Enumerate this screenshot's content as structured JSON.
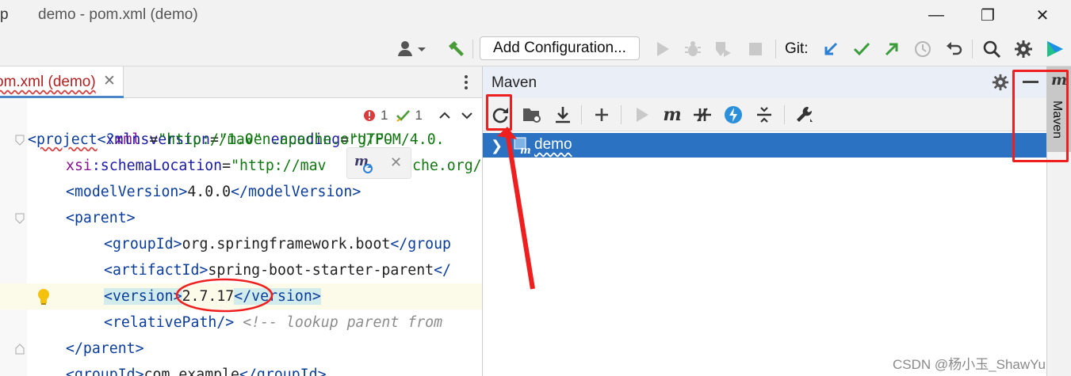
{
  "window": {
    "app_letter": "p",
    "title": "demo - pom.xml (demo)",
    "minimize": "—",
    "maximize": "❐",
    "close": "✕"
  },
  "toolbar": {
    "add_config": "Add Configuration...",
    "git_label": "Git:"
  },
  "editor_tab": {
    "label": "om.xml (demo)",
    "close": "✕"
  },
  "inspection": {
    "errors": "1",
    "warnings": "1"
  },
  "code": {
    "l1": {
      "a": "<?",
      "b": "xml",
      "c": " version",
      "d": "=",
      "e": "\"1.0\"",
      "f": " encoding",
      "g": "=",
      "h": "\"UTF-"
    },
    "l2": {
      "a": "<",
      "b": "project",
      "c": " xmlns",
      "d": "=",
      "e": "\"http://maven.apache.org/POM/4.0."
    },
    "l3": {
      "a": "xsi",
      "b": ":schemaLocation",
      "c": "=",
      "d": "\"http://mav",
      "e": "che.org/"
    },
    "l4": {
      "a": "<modelVersion>",
      "b": "4.0.0",
      "c": "</modelVersion>"
    },
    "l5": {
      "a": "<parent>"
    },
    "l6": {
      "a": "<groupId>",
      "b": "org.springframework.boot",
      "c": "</group"
    },
    "l7": {
      "a": "<artifactId>",
      "b": "spring-boot-starter-parent",
      "c": "</"
    },
    "l8": {
      "a": "<version>",
      "b": "2.7.17",
      "c": "</version>"
    },
    "l9": {
      "a": "<relativePath/>",
      "b": " <!-- lookup parent from"
    },
    "l10": {
      "a": "</parent>"
    },
    "l11": {
      "a": "<groupId>",
      "b": "com.example",
      "c": "</groupId>"
    }
  },
  "maven": {
    "title": "Maven",
    "project": "demo",
    "stripe_label": "Maven"
  },
  "watermark": "CSDN @杨小玉_ShawYu"
}
